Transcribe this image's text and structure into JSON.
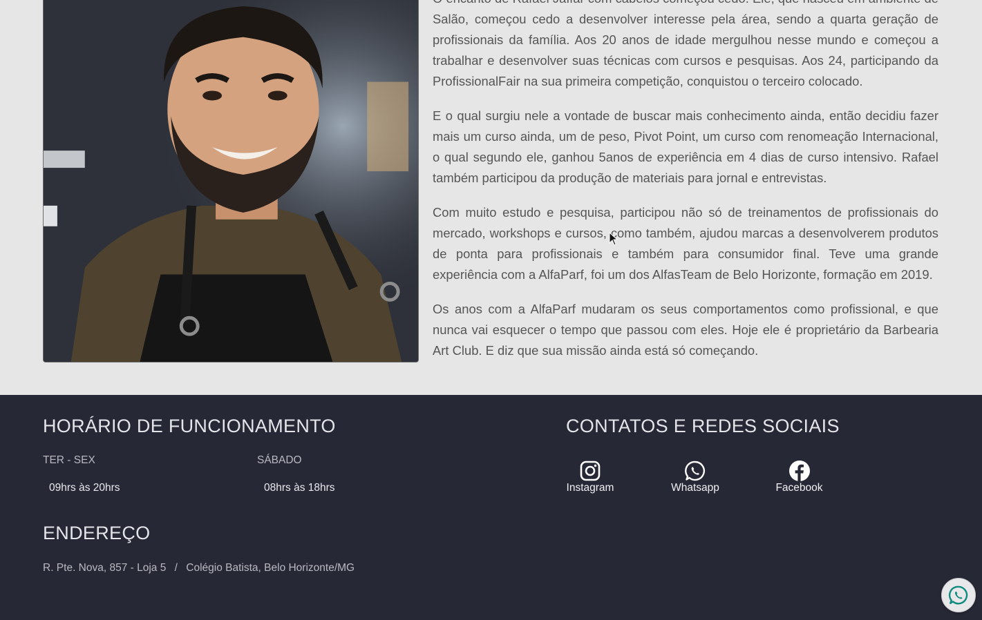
{
  "bio": {
    "paragraphs": [
      "O encanto de Rafael Jaffar com cabelos começou cedo. Ele, que nasceu em ambiente de Salão, começou cedo a desenvolver interesse pela área, sendo a quarta geração de profissionais da família. Aos 20 anos de idade mergulhou nesse mundo e começou a trabalhar e desenvolver suas técnicas com cursos e pesquisas. Aos 24, participando da ProfissionalFair na sua primeira competição, conquistou o terceiro colocado.",
      "E o qual surgiu nele a vontade de buscar mais conhecimento ainda, então decidiu fazer mais um curso ainda, um de peso, Pivot Point, um curso com renomeação Internacional, o qual segundo ele, ganhou 5anos de experiência em 4 dias de curso intensivo. Rafael também participou da produção de materiais para jornal e entrevistas.",
      "Com muito estudo e pesquisa, participou não só de treinamentos de profissionais do mercado, workshops e cursos, como também, ajudou marcas a desenvolverem produtos de ponta para profissionais e também para consumidor final. Teve uma grande experiência com a AlfaParf, foi um dos AlfasTeam de Belo Horizonte, formação em 2019.",
      "Os anos com a AlfaParf mudaram os seus comportamentos como profissional, e que nunca vai esquecer o tempo que passou com eles. Hoje ele é proprietário da Barbearia Art Club. E diz que sua missão ainda está só começando."
    ]
  },
  "hours": {
    "title": "HORÁRIO DE FUNCIONAMENTO",
    "weekday_label": "TER - SEX",
    "weekday_hours": "09hrs às 20hrs",
    "saturday_label": "SÁBADO",
    "saturday_hours": "08hrs às 18hrs"
  },
  "contacts": {
    "title": "CONTATOS E REDES SOCIAIS",
    "instagram": "Instagram",
    "whatsapp": "Whatsapp",
    "facebook": "Facebook"
  },
  "address": {
    "title": "ENDEREÇO",
    "street": "R. Pte. Nova, 857 - Loja 5",
    "separator": "/",
    "district": "Colégio Batista, Belo Horizonte/MG"
  },
  "icons": {
    "instagram": "instagram-icon",
    "whatsapp": "whatsapp-icon",
    "facebook": "facebook-icon",
    "floating": "whatsapp-icon"
  },
  "colors": {
    "footer_bg": "#272835",
    "page_bg": "#e6e6e6",
    "body_text": "#555555",
    "whatsapp_green": "#128c7e"
  }
}
